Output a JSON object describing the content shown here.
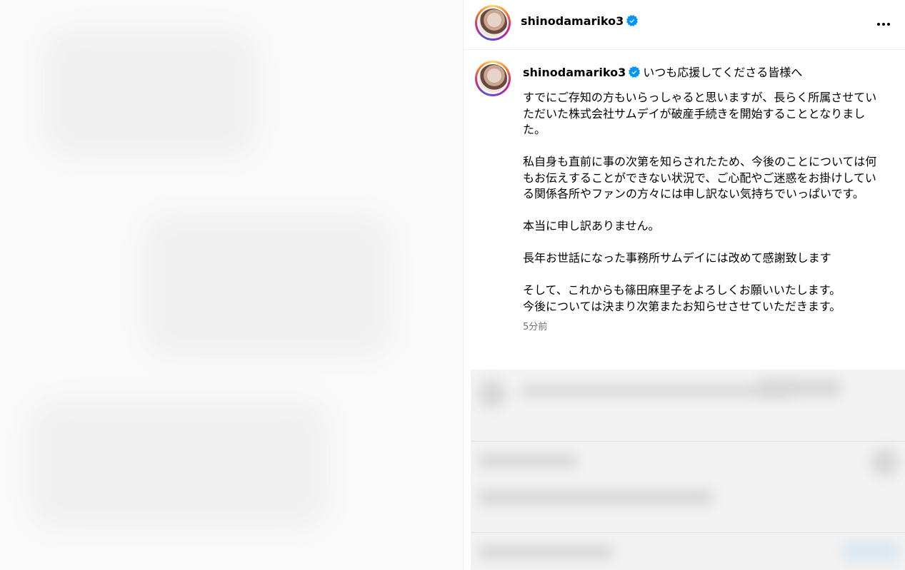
{
  "post": {
    "username": "shinodamariko3",
    "verified": true,
    "title": "いつも応援してくださる皆様へ",
    "caption": "すでにご存知の方もいらっしゃると思いますが、長らく所属させていただいた株式会社サムデイが破産手続きを開始することとなりました。\n\n私自身も直前に事の次第を知らされたため、今後のことについては何もお伝えすることができない状況で、ご心配やご迷惑をお掛けしている関係各所やファンの方々には申し訳ない気持ちでいっぱいです。\n\n本当に申し訳ありません。\n\n長年お世話になった事務所サムデイには改めて感謝致します\n\nそして、これからも篠田麻里子をよろしくお願いいたします。\n今後については決まり次第またお知らせさせていただきます。",
    "timestamp": "5分前"
  },
  "icons": {
    "verified": "verified-badge-icon",
    "more": "more-options-icon"
  },
  "colors": {
    "verified_blue": "#0095f6",
    "timestamp_gray": "#737373"
  }
}
